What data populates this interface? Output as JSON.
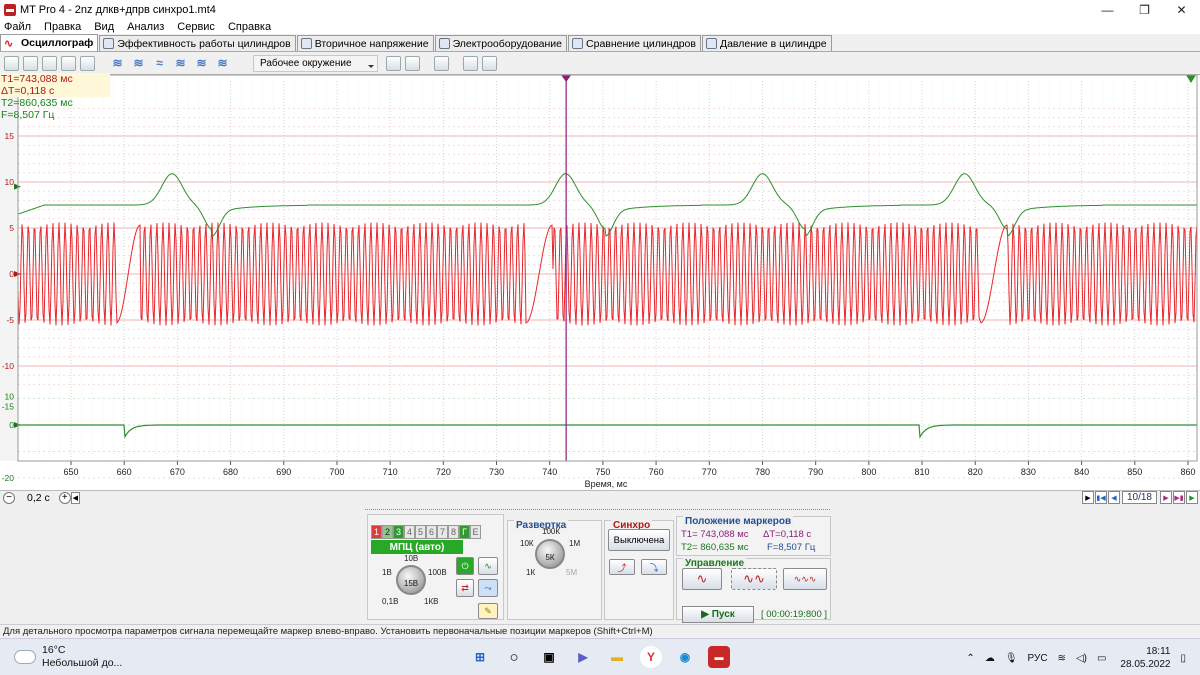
{
  "window": {
    "title": "MT Pro 4 - 2nz длкв+дпрв синхро1.mt4",
    "controls": [
      "—",
      "❐",
      "✕"
    ]
  },
  "menu": [
    "Файл",
    "Правка",
    "Вид",
    "Анализ",
    "Сервис",
    "Справка"
  ],
  "tabs": [
    {
      "label": "Осциллограф",
      "active": true
    },
    {
      "label": "Эффективность работы цилиндров"
    },
    {
      "label": "Вторичное напряжение"
    },
    {
      "label": "Электрооборудование"
    },
    {
      "label": "Сравнение цилиндров"
    },
    {
      "label": "Давление в цилиндре"
    }
  ],
  "toolbar": {
    "environment": "Рабочее окружение"
  },
  "marker_info": {
    "t1": "T1=743,088 мс",
    "dt": "ΔT=0,118 с",
    "t2": "T2=860,635 мс",
    "f": "F=8,507 Гц"
  },
  "chart_data": {
    "type": "line",
    "xlabel": "Время, мс",
    "xlim": [
      640,
      860
    ],
    "x_ticks": [
      650,
      660,
      670,
      680,
      690,
      700,
      710,
      720,
      730,
      740,
      750,
      760,
      770,
      780,
      790,
      800,
      810,
      820,
      830,
      840,
      850,
      860
    ],
    "upper_y_ticks": [
      15,
      10,
      5,
      0,
      -5,
      -10
    ],
    "lower_y_ticks": [
      10,
      -15,
      0,
      -20
    ],
    "ylim_upper": [
      -13,
      19
    ],
    "ylim_lower": [
      -21,
      12
    ],
    "marker_x": 743.088,
    "grid": true,
    "series": [
      {
        "color": "#e8262b",
        "desc": "crank sensor ~5.6 V sine, ~1.2 ms period with gap",
        "amplitude": 5.6,
        "period": 1.15,
        "gaps": [
          [
            658.5,
            663
          ],
          [
            735.5,
            740.5
          ],
          [
            821,
            826
          ]
        ]
      },
      {
        "color": "#2d8f2d",
        "desc": "cam sensor slow waveform ~7.5 V baseline with peaks ~11 V",
        "peaks": [
          669,
          743,
          780,
          818
        ],
        "troughs": [
          676.5,
          750.5,
          788,
          826
        ]
      },
      {
        "color": "#2d8f2d",
        "desc": "sync channel flat 0 with dips",
        "dips": [
          660,
          809.5
        ]
      }
    ]
  },
  "scroll": {
    "zoom": "0,2 с",
    "page": "10/18"
  },
  "ctrl": {
    "channels": [
      "1",
      "2",
      "3",
      "4",
      "5",
      "6",
      "7",
      "8",
      "Г",
      "Е"
    ],
    "mpc_label": "МПЦ (авто)",
    "v_knob": {
      "value": "15В",
      "labels": [
        "10В",
        "1В",
        "100В",
        "0,1В",
        "1КВ"
      ]
    },
    "sweep_title": "Развертка",
    "sweep_knob": {
      "value": "5К",
      "labels": [
        "100К",
        "10К",
        "1М",
        "1К",
        "5М"
      ]
    },
    "sync_title": "Синхро",
    "sync_btn": "Выключена",
    "markers_title": "Положение маркеров",
    "markers": {
      "t1": "T1= 743,088 мс",
      "dt": "ΔT=0,118 с",
      "t2": "T2= 860,635 мс",
      "f": "F=8,507 Гц"
    },
    "control_title": "Управление",
    "start": "Пуск",
    "timer": "[ 00:00:19:800 ]"
  },
  "statusbar": "Для детального просмотра параметров сигнала перемещайте маркер влево-вправо. Установить первоначальные позиции маркеров (Shift+Ctrl+M)",
  "taskbar": {
    "temp": "16°C",
    "weather": "Небольшой до...",
    "lang": "РУС",
    "time": "18:11",
    "date": "28.05.2022"
  }
}
